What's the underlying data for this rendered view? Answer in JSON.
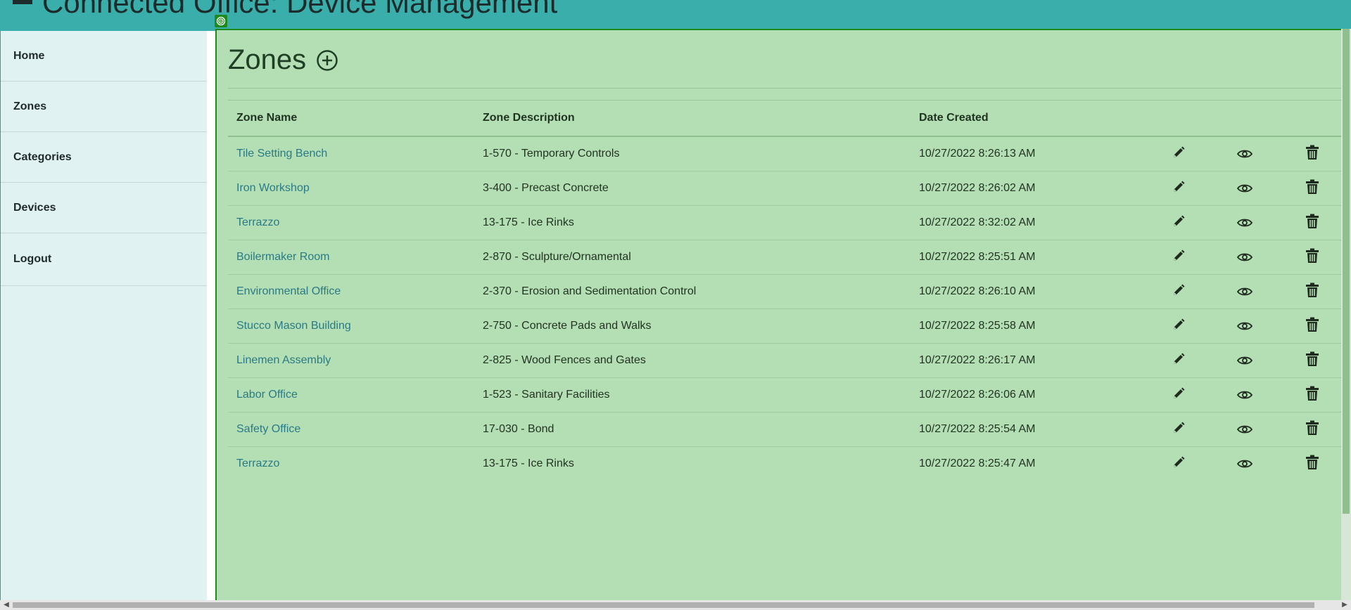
{
  "header": {
    "title": "Connected Office: Device Management"
  },
  "sidebar": {
    "items": [
      {
        "label": "Home"
      },
      {
        "label": "Zones"
      },
      {
        "label": "Categories"
      },
      {
        "label": "Devices"
      },
      {
        "label": "Logout"
      }
    ]
  },
  "main": {
    "title": "Zones",
    "add_icon": "plus-circle-icon",
    "columns": [
      "Zone Name",
      "Zone Description",
      "Date Created"
    ],
    "rows": [
      {
        "name": "Tile Setting Bench",
        "description": "1-570 - Temporary Controls",
        "date": "10/27/2022 8:26:13 AM"
      },
      {
        "name": "Iron Workshop",
        "description": "3-400 - Precast Concrete",
        "date": "10/27/2022 8:26:02 AM"
      },
      {
        "name": "Terrazzo",
        "description": "13-175 - Ice Rinks",
        "date": "10/27/2022 8:32:02 AM"
      },
      {
        "name": "Boilermaker Room",
        "description": "2-870 - Sculpture/Ornamental",
        "date": "10/27/2022 8:25:51 AM"
      },
      {
        "name": "Environmental Office",
        "description": "2-370 - Erosion and Sedimentation Control",
        "date": "10/27/2022 8:26:10 AM"
      },
      {
        "name": "Stucco Mason Building",
        "description": "2-750 - Concrete Pads and Walks",
        "date": "10/27/2022 8:25:58 AM"
      },
      {
        "name": "Linemen Assembly",
        "description": "2-825 - Wood Fences and Gates",
        "date": "10/27/2022 8:26:17 AM"
      },
      {
        "name": "Labor Office",
        "description": "1-523 - Sanitary Facilities",
        "date": "10/27/2022 8:26:06 AM"
      },
      {
        "name": "Safety Office",
        "description": "17-030 - Bond",
        "date": "10/27/2022 8:25:54 AM"
      },
      {
        "name": "Terrazzo",
        "description": "13-175 - Ice Rinks",
        "date": "10/27/2022 8:25:47 AM"
      }
    ],
    "row_actions": [
      "pencil-icon",
      "eye-icon",
      "trash-icon"
    ]
  },
  "colors": {
    "header_bg": "#3aaeaa",
    "sidebar_bg": "#e0f2f2",
    "content_bg": "#b4dfb4",
    "link": "#2a7a86",
    "selection_border": "#1e8a1e"
  }
}
